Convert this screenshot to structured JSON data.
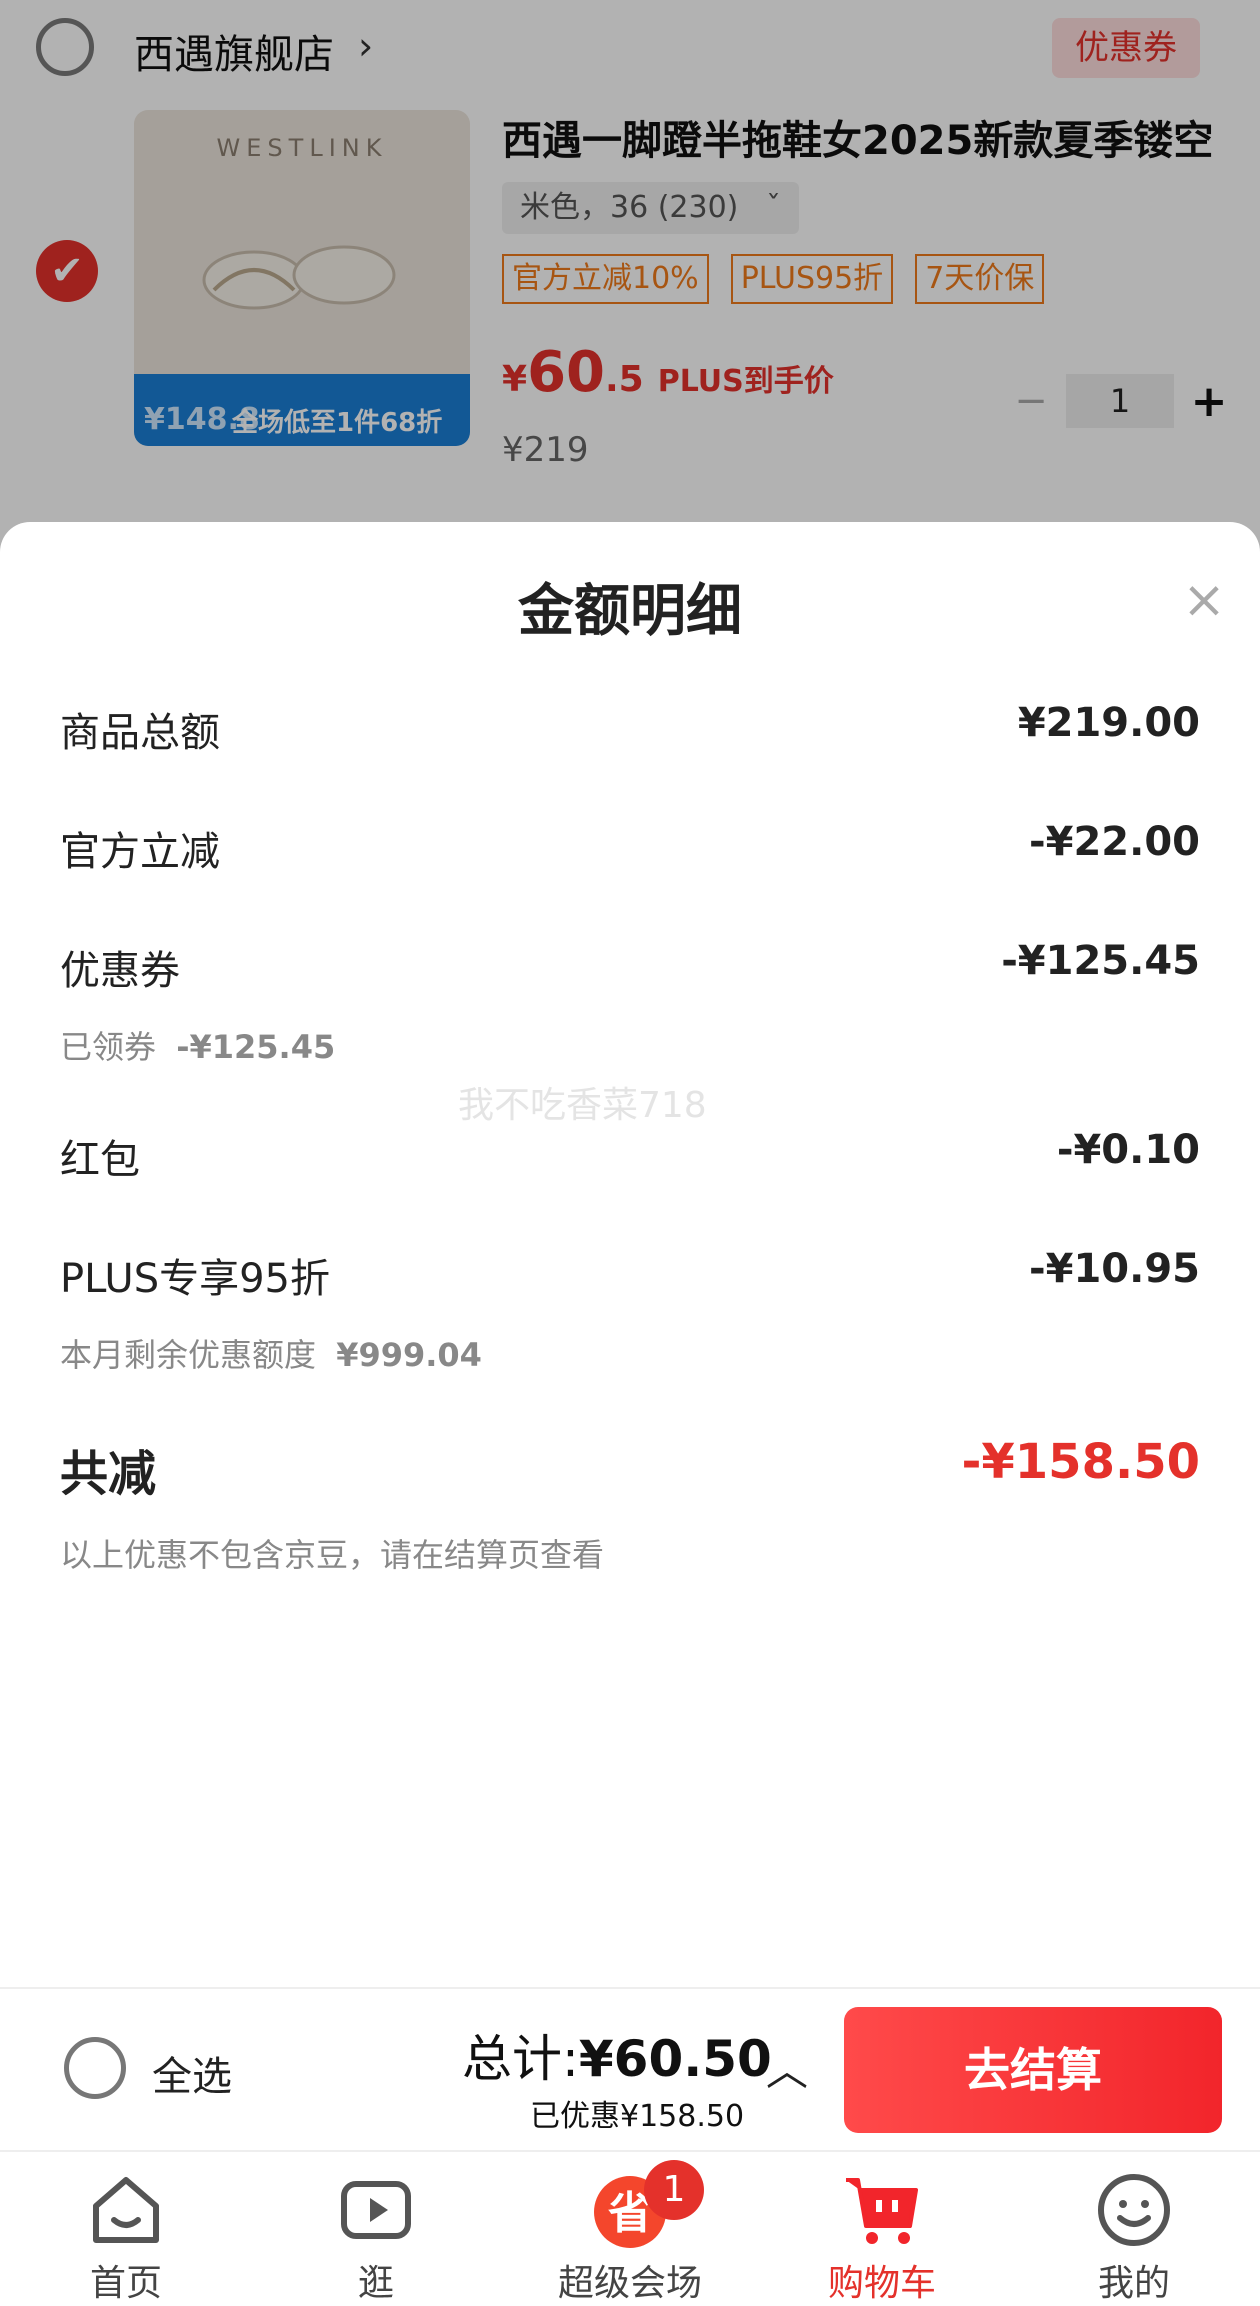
{
  "store": {
    "name": "西遇旗舰店",
    "chevron": "›",
    "coupon_tag": "优惠券"
  },
  "product": {
    "title": "西遇一脚蹬半拖鞋女2025新款夏季镂空",
    "spec": "米色，36 (230)",
    "spec_arrow": "ˇ",
    "badges": [
      "官方立减10%",
      "PLUS95折",
      "7天价保"
    ],
    "price_yen": "¥",
    "price_int": "60",
    "price_dec": ".5",
    "price_note": "PLUS到手价",
    "original_price": "¥219",
    "quantity": "1",
    "image_brand": "WESTLINK",
    "image_promo_price": "¥148.8",
    "image_promo_text": "全场低至1件68折"
  },
  "sheet": {
    "title": "金额明细",
    "close_icon": "close-icon",
    "rows": [
      {
        "label": "商品总额",
        "value": "¥219.00"
      },
      {
        "label": "官方立减",
        "value": "-¥22.00"
      },
      {
        "label": "优惠券",
        "value": "-¥125.45",
        "sub_label": "已领券",
        "sub_value": "-¥125.45"
      },
      {
        "label": "红包",
        "value": "-¥0.10"
      },
      {
        "label": "PLUS专享95折",
        "value": "-¥10.95",
        "sub_label": "本月剩余优惠额度",
        "sub_value": "¥999.04"
      }
    ],
    "total": {
      "label": "共减",
      "value": "-¥158.50",
      "note": "以上优惠不包含京豆，请在结算页查看"
    },
    "watermark": "我不吃香菜718"
  },
  "checkout": {
    "select_all": "全选",
    "total_label": "总计:",
    "total_value": "¥60.50",
    "saved": "已优惠¥158.50",
    "button": "去结算"
  },
  "tabs": [
    {
      "label": "首页",
      "icon": "home-icon"
    },
    {
      "label": "逛",
      "icon": "video-icon"
    },
    {
      "label": "超级会场",
      "icon": "super-venue-icon",
      "badge": "1"
    },
    {
      "label": "购物车",
      "icon": "cart-icon",
      "active": true
    },
    {
      "label": "我的",
      "icon": "smiley-icon"
    }
  ],
  "colors": {
    "accent": "#e4312b",
    "badge_orange": "#f07a1a"
  }
}
